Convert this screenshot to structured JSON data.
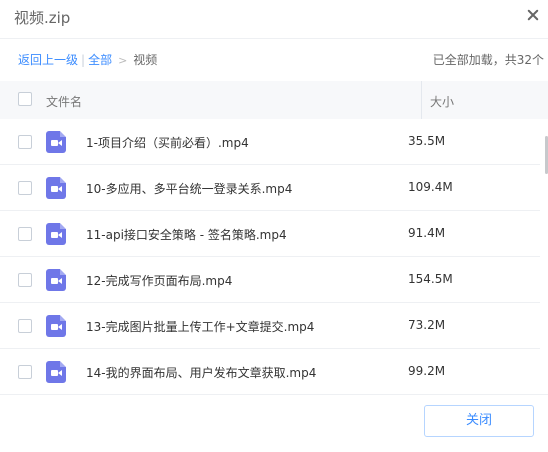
{
  "window": {
    "title": "视频.zip"
  },
  "breadcrumb": {
    "back": "返回上一级",
    "separator": "|",
    "all": "全部",
    "arrow": ">",
    "current": "视频"
  },
  "status": "已全部加载，共32个",
  "table": {
    "col_name": "文件名",
    "col_size": "大小"
  },
  "files": [
    {
      "name": "1-项目介绍（买前必看）.mp4",
      "size": "35.5M"
    },
    {
      "name": "10-多应用、多平台统一登录关系.mp4",
      "size": "109.4M"
    },
    {
      "name": "11-api接口安全策略 - 签名策略.mp4",
      "size": "91.4M"
    },
    {
      "name": "12-完成写作页面布局.mp4",
      "size": "154.5M"
    },
    {
      "name": "13-完成图片批量上传工作+文章提交.mp4",
      "size": "73.2M"
    },
    {
      "name": "14-我的界面布局、用户发布文章获取.mp4",
      "size": "99.2M"
    }
  ],
  "footer": {
    "close_label": "关闭"
  },
  "colors": {
    "accent": "#3b8cff",
    "video_icon": "#6f77e8"
  },
  "icons": {
    "file": "video-file-icon",
    "close": "close-icon"
  }
}
